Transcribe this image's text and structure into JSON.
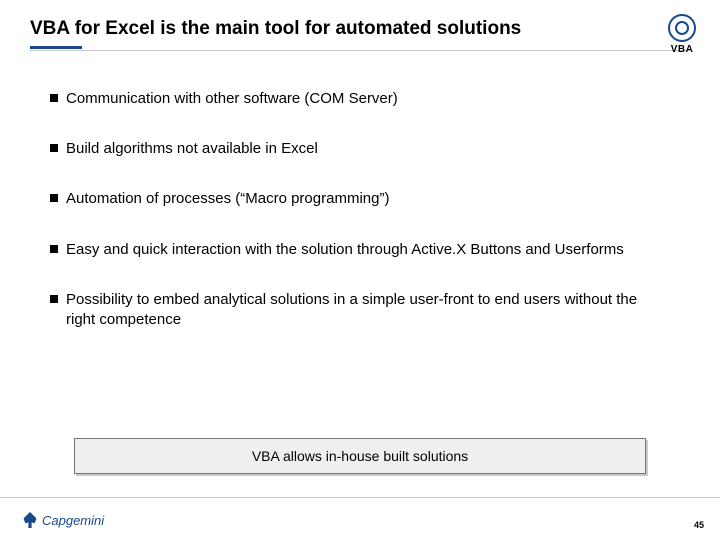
{
  "header": {
    "title": "VBA for Excel is the main tool for automated solutions",
    "corner_label": "VBA"
  },
  "bullets": [
    "Communication with other software (COM Server)",
    "Build algorithms not available in Excel",
    "Automation of processes (“Macro programming”)",
    "Easy and quick interaction with the solution through Active.X Buttons and Userforms",
    "Possibility to embed analytical solutions in a simple user-front to end users without the right competence"
  ],
  "callout": "VBA allows in-house built solutions",
  "footer": {
    "logo_text": "Capgemini",
    "page_number": "45"
  }
}
